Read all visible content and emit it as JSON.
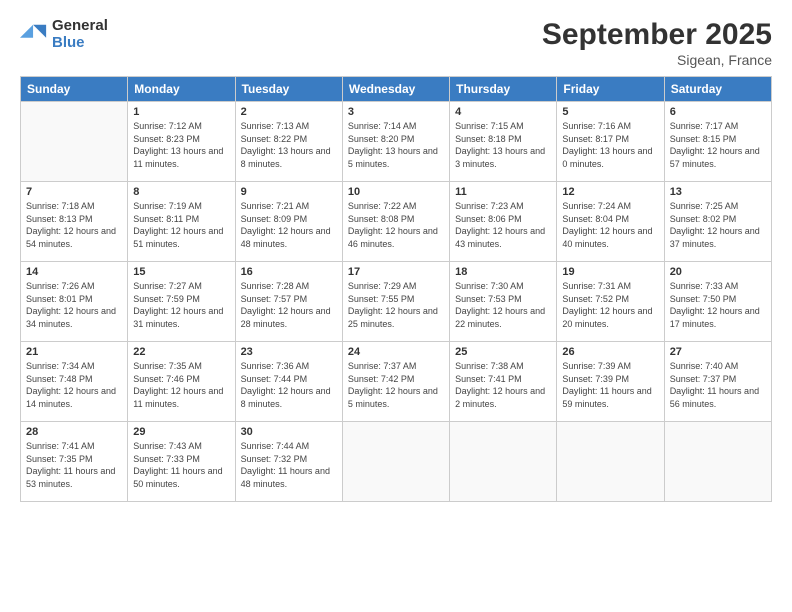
{
  "logo": {
    "general": "General",
    "blue": "Blue"
  },
  "title": "September 2025",
  "subtitle": "Sigean, France",
  "days_of_week": [
    "Sunday",
    "Monday",
    "Tuesday",
    "Wednesday",
    "Thursday",
    "Friday",
    "Saturday"
  ],
  "weeks": [
    [
      {
        "day": "",
        "sunrise": "",
        "sunset": "",
        "daylight": "",
        "empty": true
      },
      {
        "day": "1",
        "sunrise": "Sunrise: 7:12 AM",
        "sunset": "Sunset: 8:23 PM",
        "daylight": "Daylight: 13 hours and 11 minutes."
      },
      {
        "day": "2",
        "sunrise": "Sunrise: 7:13 AM",
        "sunset": "Sunset: 8:22 PM",
        "daylight": "Daylight: 13 hours and 8 minutes."
      },
      {
        "day": "3",
        "sunrise": "Sunrise: 7:14 AM",
        "sunset": "Sunset: 8:20 PM",
        "daylight": "Daylight: 13 hours and 5 minutes."
      },
      {
        "day": "4",
        "sunrise": "Sunrise: 7:15 AM",
        "sunset": "Sunset: 8:18 PM",
        "daylight": "Daylight: 13 hours and 3 minutes."
      },
      {
        "day": "5",
        "sunrise": "Sunrise: 7:16 AM",
        "sunset": "Sunset: 8:17 PM",
        "daylight": "Daylight: 13 hours and 0 minutes."
      },
      {
        "day": "6",
        "sunrise": "Sunrise: 7:17 AM",
        "sunset": "Sunset: 8:15 PM",
        "daylight": "Daylight: 12 hours and 57 minutes."
      }
    ],
    [
      {
        "day": "7",
        "sunrise": "Sunrise: 7:18 AM",
        "sunset": "Sunset: 8:13 PM",
        "daylight": "Daylight: 12 hours and 54 minutes."
      },
      {
        "day": "8",
        "sunrise": "Sunrise: 7:19 AM",
        "sunset": "Sunset: 8:11 PM",
        "daylight": "Daylight: 12 hours and 51 minutes."
      },
      {
        "day": "9",
        "sunrise": "Sunrise: 7:21 AM",
        "sunset": "Sunset: 8:09 PM",
        "daylight": "Daylight: 12 hours and 48 minutes."
      },
      {
        "day": "10",
        "sunrise": "Sunrise: 7:22 AM",
        "sunset": "Sunset: 8:08 PM",
        "daylight": "Daylight: 12 hours and 46 minutes."
      },
      {
        "day": "11",
        "sunrise": "Sunrise: 7:23 AM",
        "sunset": "Sunset: 8:06 PM",
        "daylight": "Daylight: 12 hours and 43 minutes."
      },
      {
        "day": "12",
        "sunrise": "Sunrise: 7:24 AM",
        "sunset": "Sunset: 8:04 PM",
        "daylight": "Daylight: 12 hours and 40 minutes."
      },
      {
        "day": "13",
        "sunrise": "Sunrise: 7:25 AM",
        "sunset": "Sunset: 8:02 PM",
        "daylight": "Daylight: 12 hours and 37 minutes."
      }
    ],
    [
      {
        "day": "14",
        "sunrise": "Sunrise: 7:26 AM",
        "sunset": "Sunset: 8:01 PM",
        "daylight": "Daylight: 12 hours and 34 minutes."
      },
      {
        "day": "15",
        "sunrise": "Sunrise: 7:27 AM",
        "sunset": "Sunset: 7:59 PM",
        "daylight": "Daylight: 12 hours and 31 minutes."
      },
      {
        "day": "16",
        "sunrise": "Sunrise: 7:28 AM",
        "sunset": "Sunset: 7:57 PM",
        "daylight": "Daylight: 12 hours and 28 minutes."
      },
      {
        "day": "17",
        "sunrise": "Sunrise: 7:29 AM",
        "sunset": "Sunset: 7:55 PM",
        "daylight": "Daylight: 12 hours and 25 minutes."
      },
      {
        "day": "18",
        "sunrise": "Sunrise: 7:30 AM",
        "sunset": "Sunset: 7:53 PM",
        "daylight": "Daylight: 12 hours and 22 minutes."
      },
      {
        "day": "19",
        "sunrise": "Sunrise: 7:31 AM",
        "sunset": "Sunset: 7:52 PM",
        "daylight": "Daylight: 12 hours and 20 minutes."
      },
      {
        "day": "20",
        "sunrise": "Sunrise: 7:33 AM",
        "sunset": "Sunset: 7:50 PM",
        "daylight": "Daylight: 12 hours and 17 minutes."
      }
    ],
    [
      {
        "day": "21",
        "sunrise": "Sunrise: 7:34 AM",
        "sunset": "Sunset: 7:48 PM",
        "daylight": "Daylight: 12 hours and 14 minutes."
      },
      {
        "day": "22",
        "sunrise": "Sunrise: 7:35 AM",
        "sunset": "Sunset: 7:46 PM",
        "daylight": "Daylight: 12 hours and 11 minutes."
      },
      {
        "day": "23",
        "sunrise": "Sunrise: 7:36 AM",
        "sunset": "Sunset: 7:44 PM",
        "daylight": "Daylight: 12 hours and 8 minutes."
      },
      {
        "day": "24",
        "sunrise": "Sunrise: 7:37 AM",
        "sunset": "Sunset: 7:42 PM",
        "daylight": "Daylight: 12 hours and 5 minutes."
      },
      {
        "day": "25",
        "sunrise": "Sunrise: 7:38 AM",
        "sunset": "Sunset: 7:41 PM",
        "daylight": "Daylight: 12 hours and 2 minutes."
      },
      {
        "day": "26",
        "sunrise": "Sunrise: 7:39 AM",
        "sunset": "Sunset: 7:39 PM",
        "daylight": "Daylight: 11 hours and 59 minutes."
      },
      {
        "day": "27",
        "sunrise": "Sunrise: 7:40 AM",
        "sunset": "Sunset: 7:37 PM",
        "daylight": "Daylight: 11 hours and 56 minutes."
      }
    ],
    [
      {
        "day": "28",
        "sunrise": "Sunrise: 7:41 AM",
        "sunset": "Sunset: 7:35 PM",
        "daylight": "Daylight: 11 hours and 53 minutes."
      },
      {
        "day": "29",
        "sunrise": "Sunrise: 7:43 AM",
        "sunset": "Sunset: 7:33 PM",
        "daylight": "Daylight: 11 hours and 50 minutes."
      },
      {
        "day": "30",
        "sunrise": "Sunrise: 7:44 AM",
        "sunset": "Sunset: 7:32 PM",
        "daylight": "Daylight: 11 hours and 48 minutes."
      },
      {
        "day": "",
        "sunrise": "",
        "sunset": "",
        "daylight": "",
        "empty": true
      },
      {
        "day": "",
        "sunrise": "",
        "sunset": "",
        "daylight": "",
        "empty": true
      },
      {
        "day": "",
        "sunrise": "",
        "sunset": "",
        "daylight": "",
        "empty": true
      },
      {
        "day": "",
        "sunrise": "",
        "sunset": "",
        "daylight": "",
        "empty": true
      }
    ]
  ]
}
